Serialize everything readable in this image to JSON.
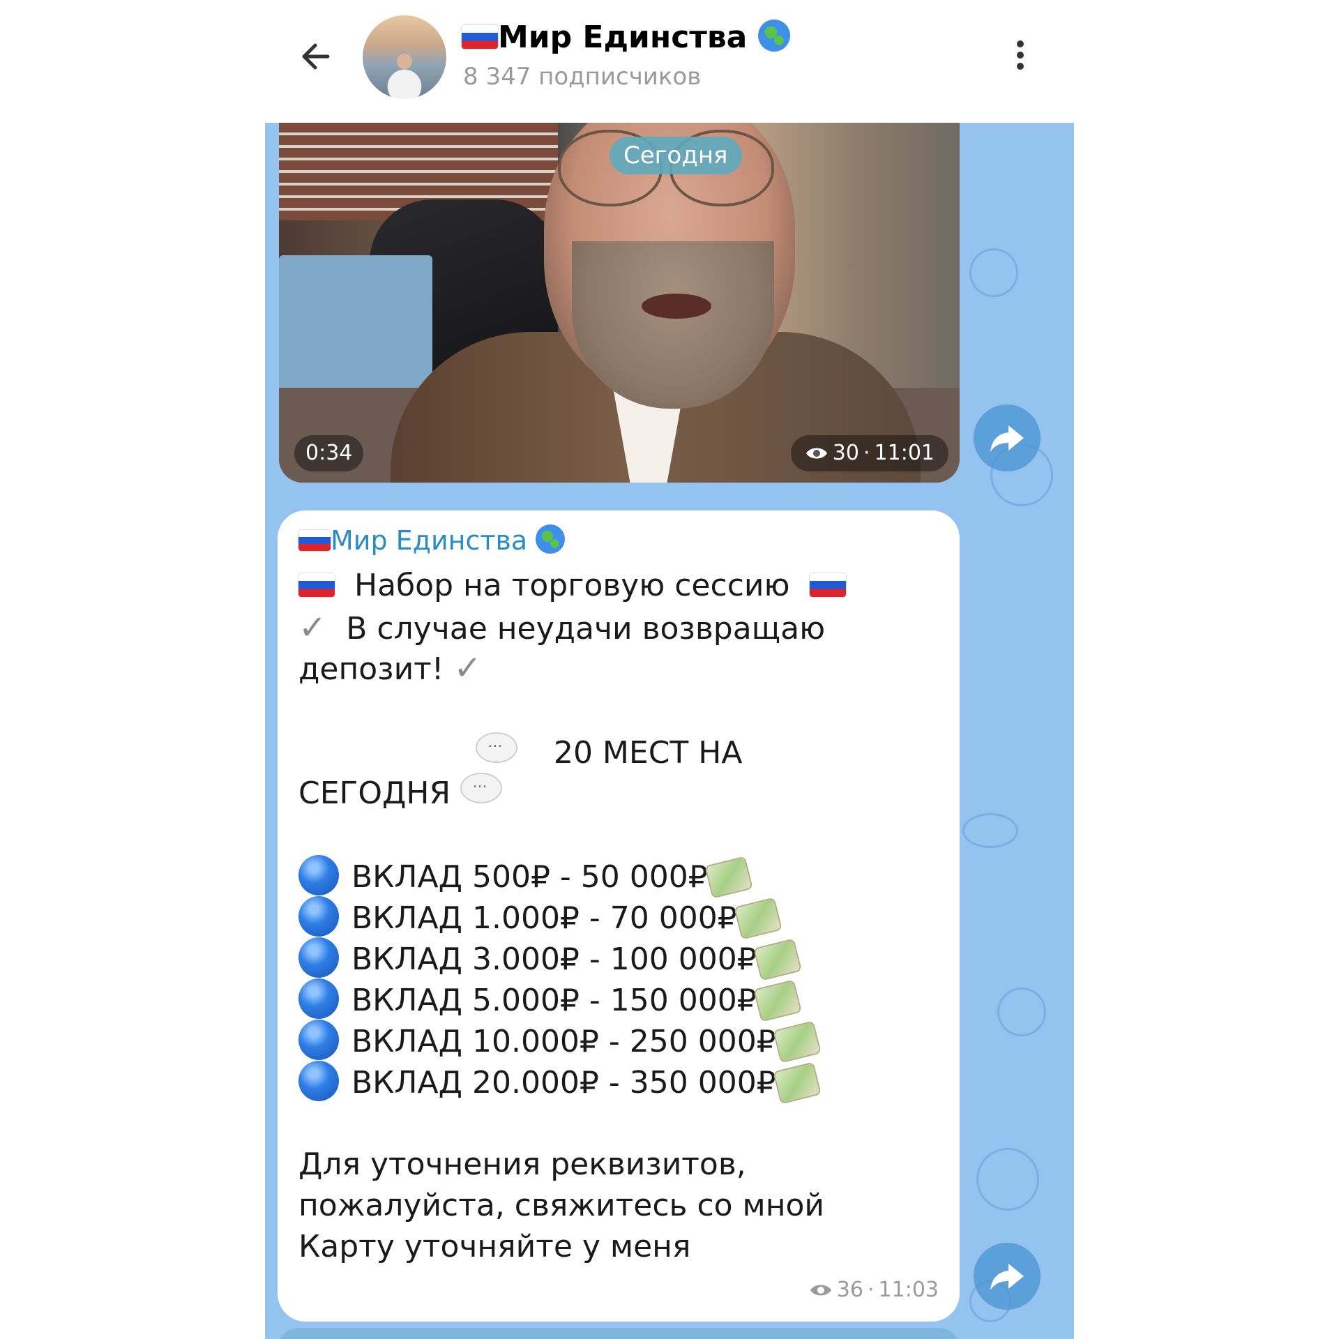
{
  "header": {
    "channel_title": "Мир Единства",
    "subscribers": "8 347 подписчиков",
    "back_icon": "arrow-left-icon",
    "menu_icon": "more-vertical-icon"
  },
  "video_post": {
    "date_label": "Сегодня",
    "duration": "0:34",
    "views": "30",
    "time": "11:01"
  },
  "text_post": {
    "author": "Мир Единства",
    "line1": "Набор на торговую сессию",
    "line2": "В случае неудачи возвращаю",
    "line3": "депозит!",
    "line4": "20 МЕСТ НА",
    "line5": "СЕГОДНЯ",
    "deposits": [
      "ВКЛАД 500₽ - 50 000₽",
      "ВКЛАД 1.000₽ - 70 000₽",
      "ВКЛАД 3.000₽ - 100 000₽",
      "ВКЛАД 5.000₽ - 150 000₽",
      "ВКЛАД 10.000₽ - 250 000₽",
      "ВКЛАД 20.000₽ - 350 000₽"
    ],
    "footer1": "Для уточнения реквизитов,",
    "footer2": "пожалуйста, свяжитесь со мной",
    "footer3": "Карту уточняйте у меня",
    "views": "36",
    "time": "11:03"
  },
  "colors": {
    "chat_background": "#93c3ee",
    "author_link": "#2a8cc4",
    "share_button": "#4a94d2"
  }
}
